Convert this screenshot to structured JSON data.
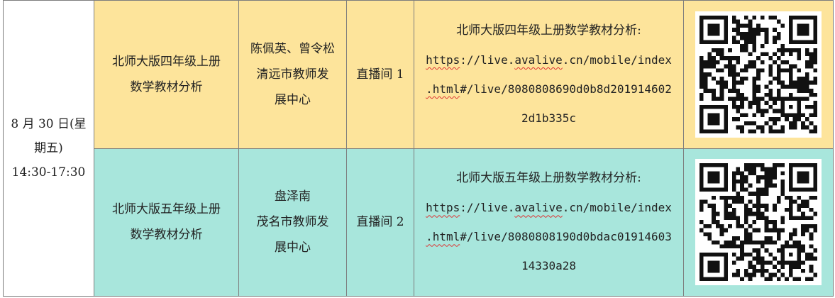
{
  "schedule": {
    "date_lines": [
      "8 月 30 日(星",
      "期五)",
      "14:30-17:30"
    ],
    "rows": [
      {
        "topic_lines": [
          "北师大版四年级上册",
          "数学教材分析"
        ],
        "presenter_lines": [
          "陈佩英、曾令松",
          "清远市教师发",
          "展中心"
        ],
        "room": "直播间 1",
        "link_heading": "北师大版四年级上册数学教材分析:",
        "link_line1_a": "https",
        "link_line1_b": "://live.",
        "link_line1_c": "avalive",
        "link_line1_d": ".cn/mobile/index",
        "link_line2_a": ".html",
        "link_line2_b": "#/live/8080808690d0b8d201914602",
        "link_line3": "2d1b335c",
        "qr_label": "qr-code"
      },
      {
        "topic_lines": [
          "北师大版五年级上册",
          "数学教材分析"
        ],
        "presenter_lines": [
          "盘泽南",
          "茂名市教师发",
          "展中心"
        ],
        "room": "直播间 2",
        "link_heading": "北师大版五年级上册数学教材分析:",
        "link_line1_a": "https",
        "link_line1_b": "://live.",
        "link_line1_c": "avalive",
        "link_line1_d": ".cn/mobile/index",
        "link_line2_a": ".html",
        "link_line2_b": "#/live/8080808190d0bdac01914603",
        "link_line3": "14330a28",
        "qr_label": "qr-code"
      }
    ],
    "colors": {
      "row_a": "#fde49b",
      "row_b": "#a8e6dc",
      "border": "#7d7d7d"
    }
  }
}
